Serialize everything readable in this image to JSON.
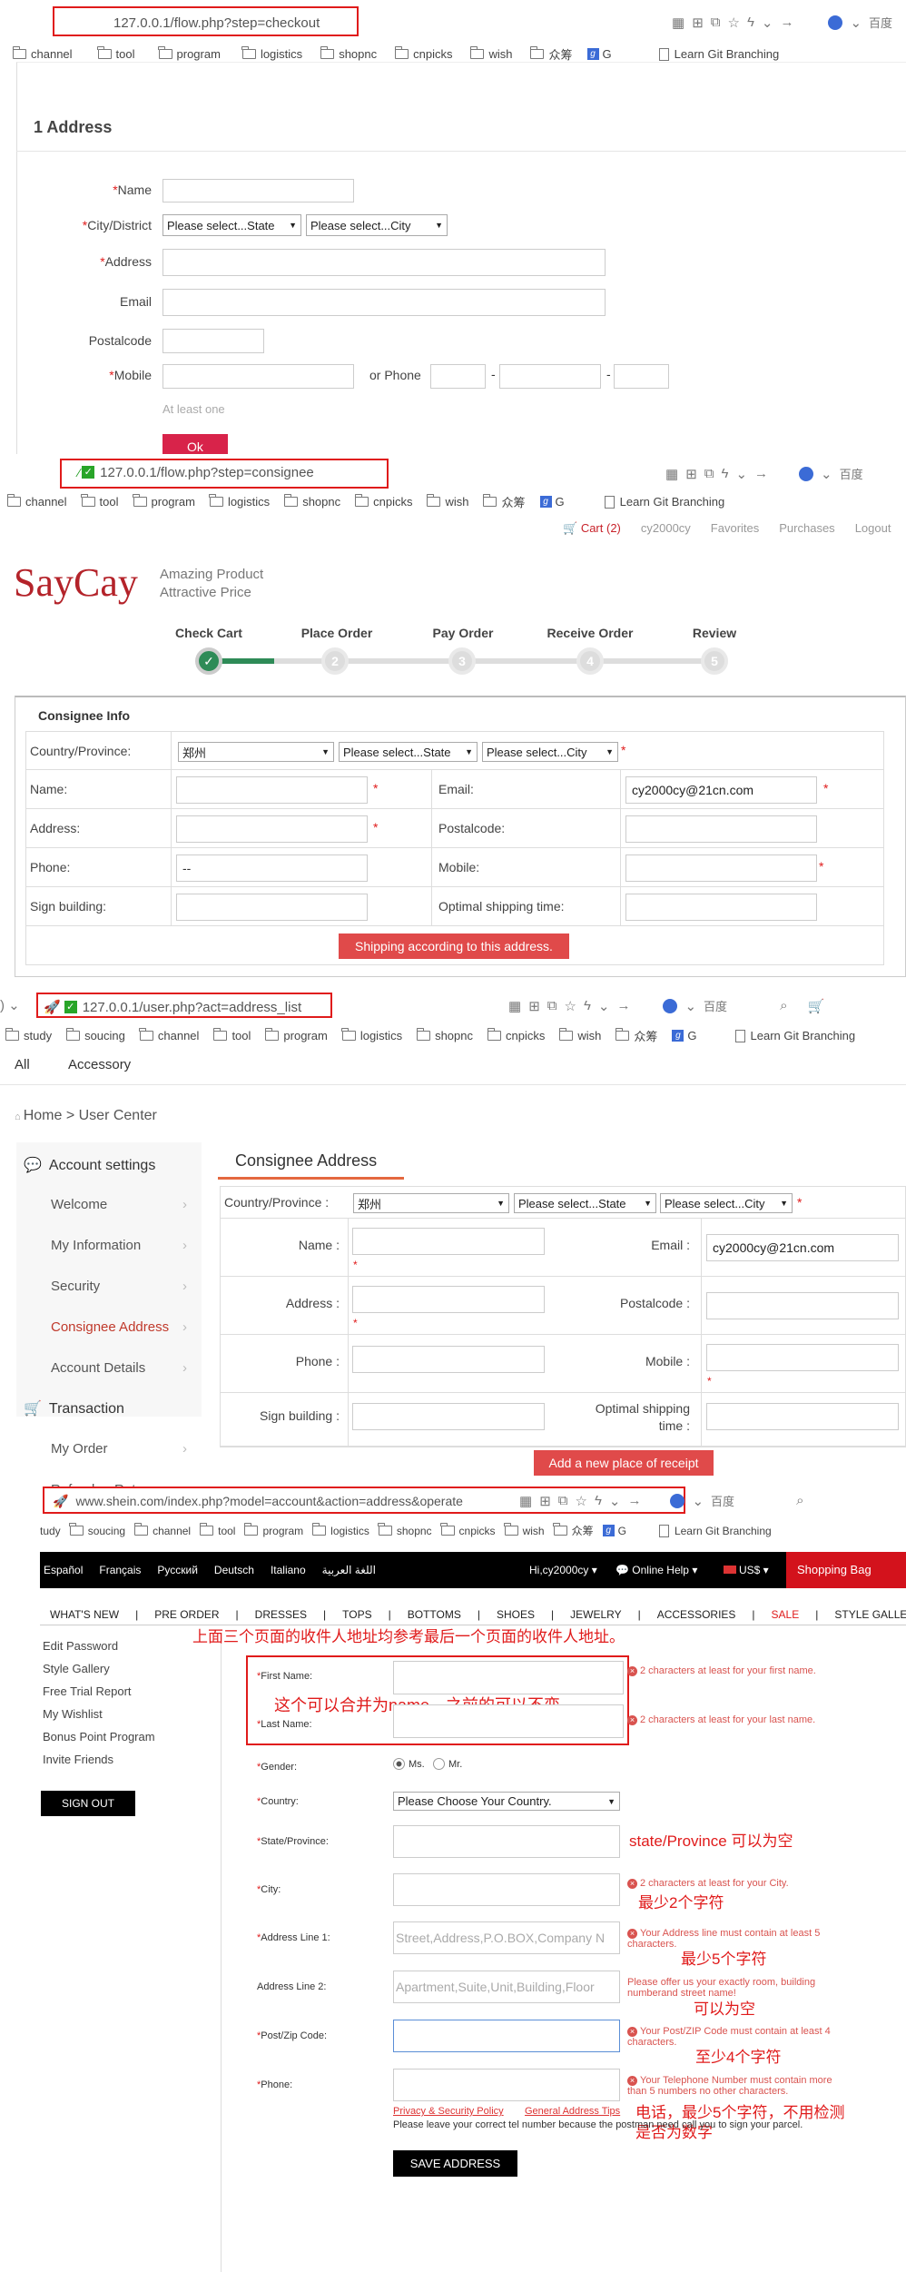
{
  "s1": {
    "url": "127.0.0.1/flow.php?step=checkout",
    "cn_label": "百度",
    "bookmarks": [
      "channel",
      "tool",
      "program",
      "logistics",
      "shopnc",
      "cnpicks",
      "wish",
      "众筹",
      "G",
      "Learn Git Branching"
    ],
    "heading": "1 Address",
    "name": "Name",
    "city": "City/District",
    "state_sel": "Please select...State",
    "city_sel": "Please select...City",
    "address": "Address",
    "email": "Email",
    "postal": "Postalcode",
    "mobile": "Mobile",
    "or_phone": "or Phone",
    "dash": "-",
    "hint": "At least one",
    "ok": "Ok",
    "req": "*"
  },
  "s2": {
    "url": "127.0.0.1/flow.php?step=consignee",
    "cn_label": "百度",
    "bookmarks": [
      "channel",
      "tool",
      "program",
      "logistics",
      "shopnc",
      "cnpicks",
      "wish",
      "众筹",
      "G",
      "Learn Git Branching"
    ],
    "cart": "Cart (2)",
    "user": "cy2000cy",
    "favorites": "Favorites",
    "purchases": "Purchases",
    "logout": "Logout",
    "logo": "SayCay",
    "tag1": "Amazing Product",
    "tag2": "Attractive Price",
    "steps": [
      "Check Cart",
      "Place Order",
      "Pay Order",
      "Receive Order",
      "Review"
    ],
    "step_nums": [
      "2",
      "3",
      "4",
      "5"
    ],
    "title": "Consignee Info",
    "country": "Country/Province:",
    "country_val": "郑州",
    "state_sel": "Please select...State",
    "city_sel": "Please select...City",
    "name": "Name:",
    "email": "Email:",
    "email_val": "cy2000cy@21cn.com",
    "address": "Address:",
    "postal": "Postalcode:",
    "phone": "Phone:",
    "phone_val": "--",
    "mobile": "Mobile:",
    "sign": "Sign building:",
    "optimal": "Optimal shipping time:",
    "button": "Shipping according to this address.",
    "req": "*"
  },
  "s3": {
    "url": "127.0.0.1/user.php?act=address_list",
    "cn_label": "百度",
    "bookmarks": [
      "study",
      "soucing",
      "channel",
      "tool",
      "program",
      "logistics",
      "shopnc",
      "cnpicks",
      "wish",
      "众筹",
      "G",
      "Learn Git Branching"
    ],
    "nav": [
      "All",
      "Accessory"
    ],
    "breadcrumb": "Home > User Center",
    "side_head1": "Account settings",
    "side_items": [
      "Welcome",
      "My Information",
      "Security",
      "Consignee Address",
      "Account Details"
    ],
    "side_head2": "Transaction",
    "side_items2": [
      "My Order",
      "Refund or Return"
    ],
    "title": "Consignee Address",
    "country": "Country/Province :",
    "country_val": "郑州",
    "state_sel": "Please select...State",
    "city_sel": "Please select...City",
    "name": "Name :",
    "email": "Email :",
    "email_val": "cy2000cy@21cn.com",
    "address": "Address :",
    "postal": "Postalcode :",
    "phone": "Phone :",
    "mobile": "Mobile :",
    "sign": "Sign building :",
    "optimal1": "Optimal shipping",
    "optimal2": "time :",
    "button": "Add a new place of receipt",
    "req": "*"
  },
  "s4": {
    "url": "www.shein.com/index.php?model=account&action=address&operate",
    "cn_label": "百度",
    "bookmarks": [
      "tudy",
      "soucing",
      "channel",
      "tool",
      "program",
      "logistics",
      "shopnc",
      "cnpicks",
      "wish",
      "众筹",
      "G",
      "Learn Git Branching"
    ],
    "langs": [
      "Español",
      "Français",
      "Русский",
      "Deutsch",
      "Italiano",
      "اللغة العربية"
    ],
    "hi": "Hi,cy2000cy ▾",
    "help": "Online Help ▾",
    "currency": "US$ ▾",
    "bag": "Shopping Bag",
    "menu": [
      "WHAT'S NEW",
      "PRE ORDER",
      "DRESSES",
      "TOPS",
      "BOTTOMS",
      "SHOES",
      "JEWELRY",
      "ACCESSORIES",
      "SALE",
      "STYLE GALLER"
    ],
    "side": [
      "Edit Password",
      "Style Gallery",
      "Free Trial Report",
      "My Wishlist",
      "Bonus Point Program",
      "Invite Friends"
    ],
    "signout": "SIGN OUT",
    "note_top": "上面三个页面的收件人地址均参考最后一个页面的收件人地址。",
    "note_name": "这个可以合并为name，之前的可以不变。",
    "first": "First Name:",
    "last": "Last Name:",
    "gender": "Gender:",
    "ms": "Ms.",
    "mr": "Mr.",
    "country": "Country:",
    "country_sel": "Please Choose Your Country.",
    "state": "State/Province:",
    "city": "City:",
    "addr1": "Address Line 1:",
    "addr1_ph": "Street,Address,P.O.BOX,Company N",
    "addr2": "Address Line 2:",
    "addr2_ph": "Apartment,Suite,Unit,Building,Floor",
    "zip": "Post/Zip Code:",
    "phone": "Phone:",
    "err_first": "2 characters at least for your first name.",
    "err_last": "2 characters at least for your last name.",
    "err_city": "2 characters at least for your City.",
    "err_addr1": "Your Address line must contain at least 5 characters.",
    "err_addr2": "Please offer us your exactly room, building numberand street name!",
    "err_zip": "Your Post/ZIP Code must contain at least 4 characters.",
    "err_phone": "Your Telephone Number must contain more than 5 numbers no other characters.",
    "n_state": "state/Province 可以为空",
    "n_city": "最少2个字符",
    "n_addr1": "最少5个字符",
    "n_addr2": "可以为空",
    "n_zip": "至少4个字符",
    "n_phone1": "电话，最少5个字符，不用检测",
    "n_phone2": "是否为数字",
    "link1": "Privacy & Security Policy",
    "link2": "General Address Tips",
    "tel_note": "Please leave your correct tel number because the postman need call you to sign your parcel.",
    "save": "SAVE ADDRESS",
    "req": "*"
  }
}
